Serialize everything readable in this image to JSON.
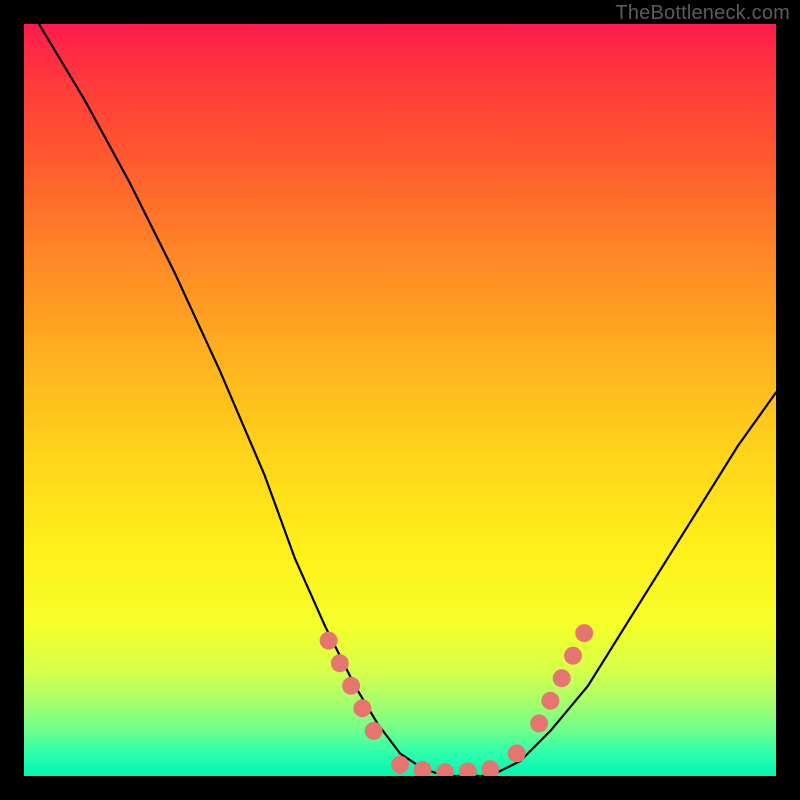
{
  "watermark": "TheBottleneck.com",
  "chart_data": {
    "type": "line",
    "title": "",
    "xlabel": "",
    "ylabel": "",
    "xlim": [
      0,
      100
    ],
    "ylim": [
      0,
      100
    ],
    "series": [
      {
        "name": "curve",
        "x": [
          2,
          8,
          14,
          20,
          26,
          32,
          36,
          40,
          44,
          47,
          50,
          53,
          56,
          59,
          62,
          66,
          70,
          75,
          80,
          85,
          90,
          95,
          100
        ],
        "y": [
          100,
          90,
          79,
          67,
          54,
          40,
          29,
          20,
          12,
          7,
          3,
          1,
          0,
          0,
          0,
          2,
          6,
          12,
          20,
          28,
          36,
          44,
          51
        ]
      }
    ],
    "highlight_points": {
      "color": "#e5766f",
      "points": [
        {
          "x": 40.5,
          "y": 18
        },
        {
          "x": 42.0,
          "y": 15
        },
        {
          "x": 43.5,
          "y": 12
        },
        {
          "x": 45.0,
          "y": 9
        },
        {
          "x": 46.5,
          "y": 6
        },
        {
          "x": 50.0,
          "y": 1.5
        },
        {
          "x": 53.0,
          "y": 0.8
        },
        {
          "x": 56.0,
          "y": 0.5
        },
        {
          "x": 59.0,
          "y": 0.6
        },
        {
          "x": 62.0,
          "y": 0.9
        },
        {
          "x": 65.5,
          "y": 3
        },
        {
          "x": 68.5,
          "y": 7
        },
        {
          "x": 70.0,
          "y": 10
        },
        {
          "x": 71.5,
          "y": 13
        },
        {
          "x": 73.0,
          "y": 16
        },
        {
          "x": 74.5,
          "y": 19
        }
      ]
    }
  }
}
